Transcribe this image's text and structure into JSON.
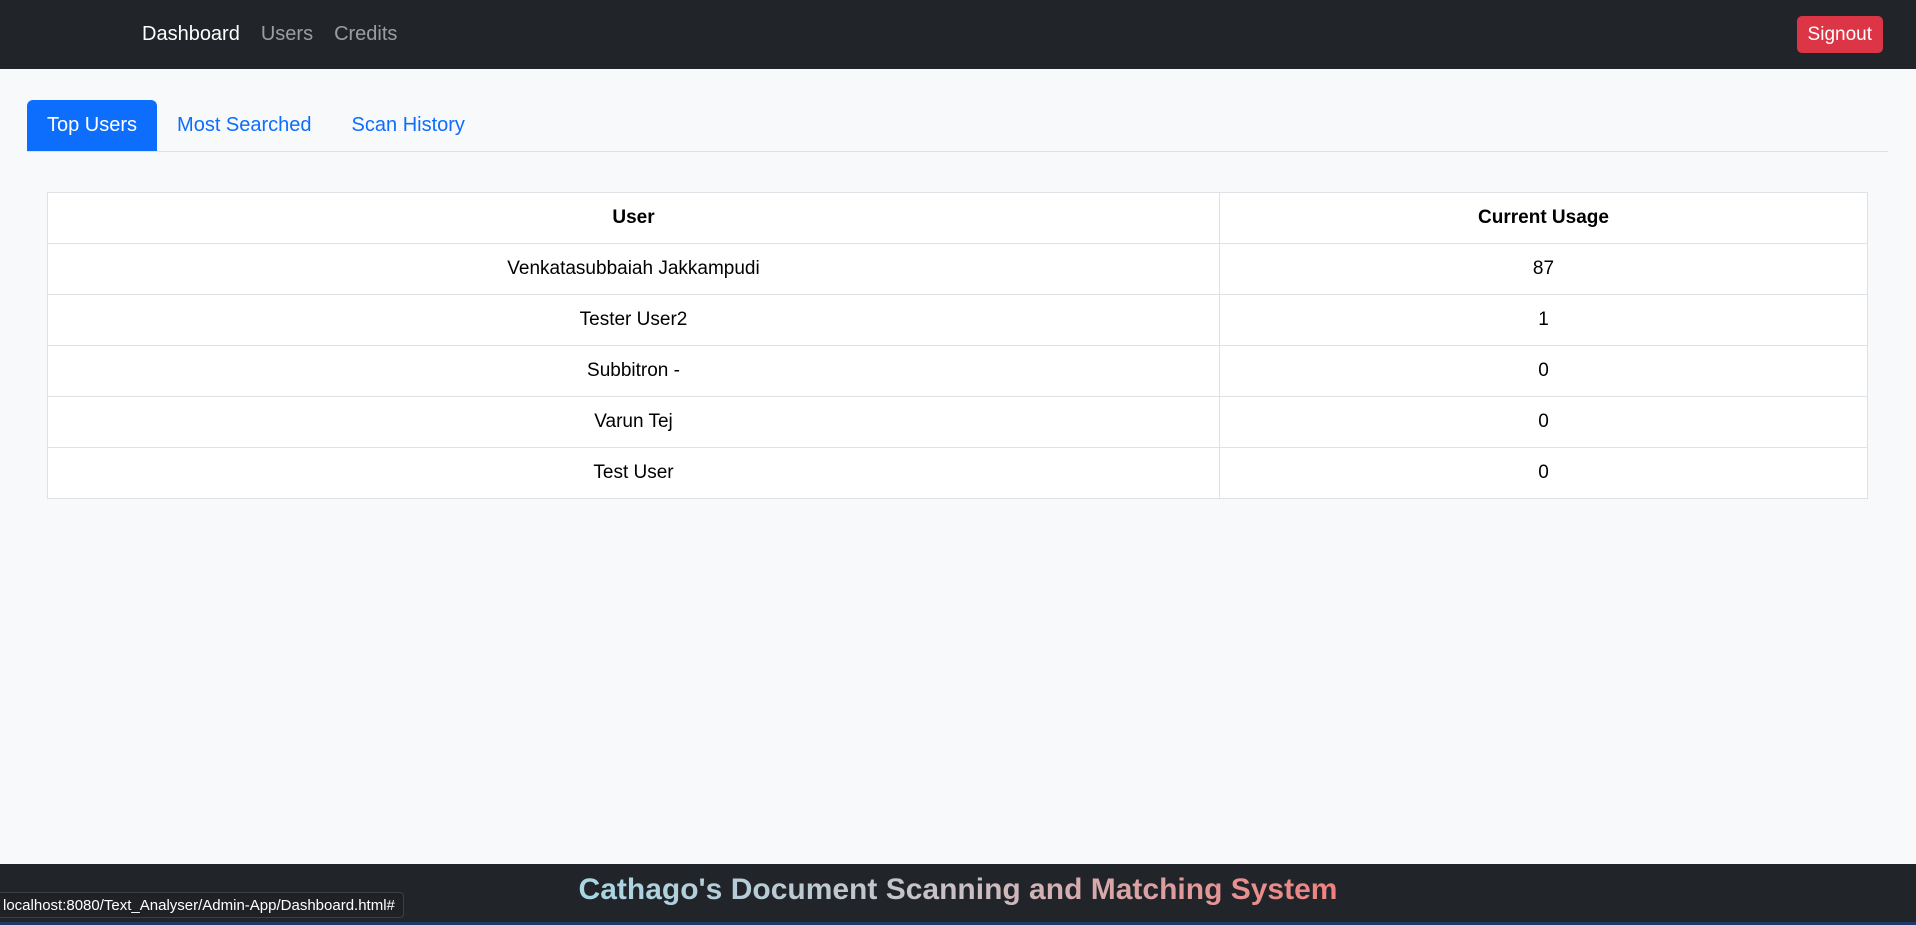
{
  "navbar": {
    "links": [
      {
        "label": "Dashboard",
        "active": true
      },
      {
        "label": "Users",
        "active": false
      },
      {
        "label": "Credits",
        "active": false
      }
    ],
    "signout_label": "Signout"
  },
  "tabs": [
    {
      "label": "Top Users",
      "active": true
    },
    {
      "label": "Most Searched",
      "active": false
    },
    {
      "label": "Scan History",
      "active": false
    }
  ],
  "table": {
    "headers": [
      "User",
      "Current Usage"
    ],
    "rows": [
      {
        "user": "Venkatasubbaiah Jakkampudi",
        "usage": "87"
      },
      {
        "user": "Tester User2",
        "usage": "1"
      },
      {
        "user": "Subbitron -",
        "usage": "0"
      },
      {
        "user": "Varun Tej",
        "usage": "0"
      },
      {
        "user": "Test User",
        "usage": "0"
      }
    ]
  },
  "footer": {
    "title": "Cathago's Document Scanning and Matching System"
  },
  "status_bar": {
    "url": "localhost:8080/Text_Analyser/Admin-App/Dashboard.html#"
  },
  "colors": {
    "navbar_bg": "#212529",
    "accent": "#0d6efd",
    "danger": "#dc3545",
    "page_bg": "#f8f9fa"
  }
}
